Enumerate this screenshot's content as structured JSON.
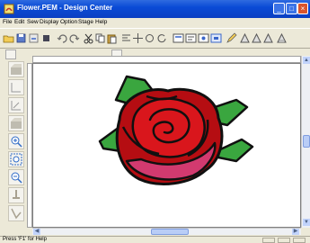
{
  "window": {
    "title": "Flower.PEM - Design Center",
    "controls": [
      "minimize",
      "maximize",
      "close"
    ]
  },
  "menu": {
    "items": [
      "File",
      "Edit",
      "Sew",
      "Display",
      "Option",
      "Stage",
      "Help"
    ]
  },
  "toolbar": {
    "icons": [
      "open-icon",
      "save-icon",
      "reload-icon",
      "stop-icon",
      "undo-icon",
      "redo-icon",
      "cut-icon",
      "copy-icon",
      "paste-icon",
      "align-icon",
      "move-icon",
      "rotate-icon",
      "refresh-icon",
      "view-icon",
      "properties-icon",
      "preview-icon",
      "settings-icon",
      "edit-icon",
      "zoom-in-icon",
      "zoom-out-icon",
      "zoom-fit-icon",
      "center-icon"
    ]
  },
  "palette": {
    "icons": [
      "select-tool-icon",
      "line-tool-icon",
      "curve-tool-icon",
      "fill-tool-icon",
      "zoom-in-icon",
      "zoom-fit-icon",
      "zoom-out-icon",
      "pin-tool-icon",
      "node-tool-icon"
    ]
  },
  "canvas": {
    "design": "rose embroidery",
    "colors": {
      "petal_dark": "#b50d12",
      "petal_mid": "#d9161c",
      "petal_pink": "#d23a6f",
      "leaf": "#3aa63f",
      "outline": "#101010"
    }
  },
  "status": {
    "help_text": "Press 'F1' for Help"
  }
}
